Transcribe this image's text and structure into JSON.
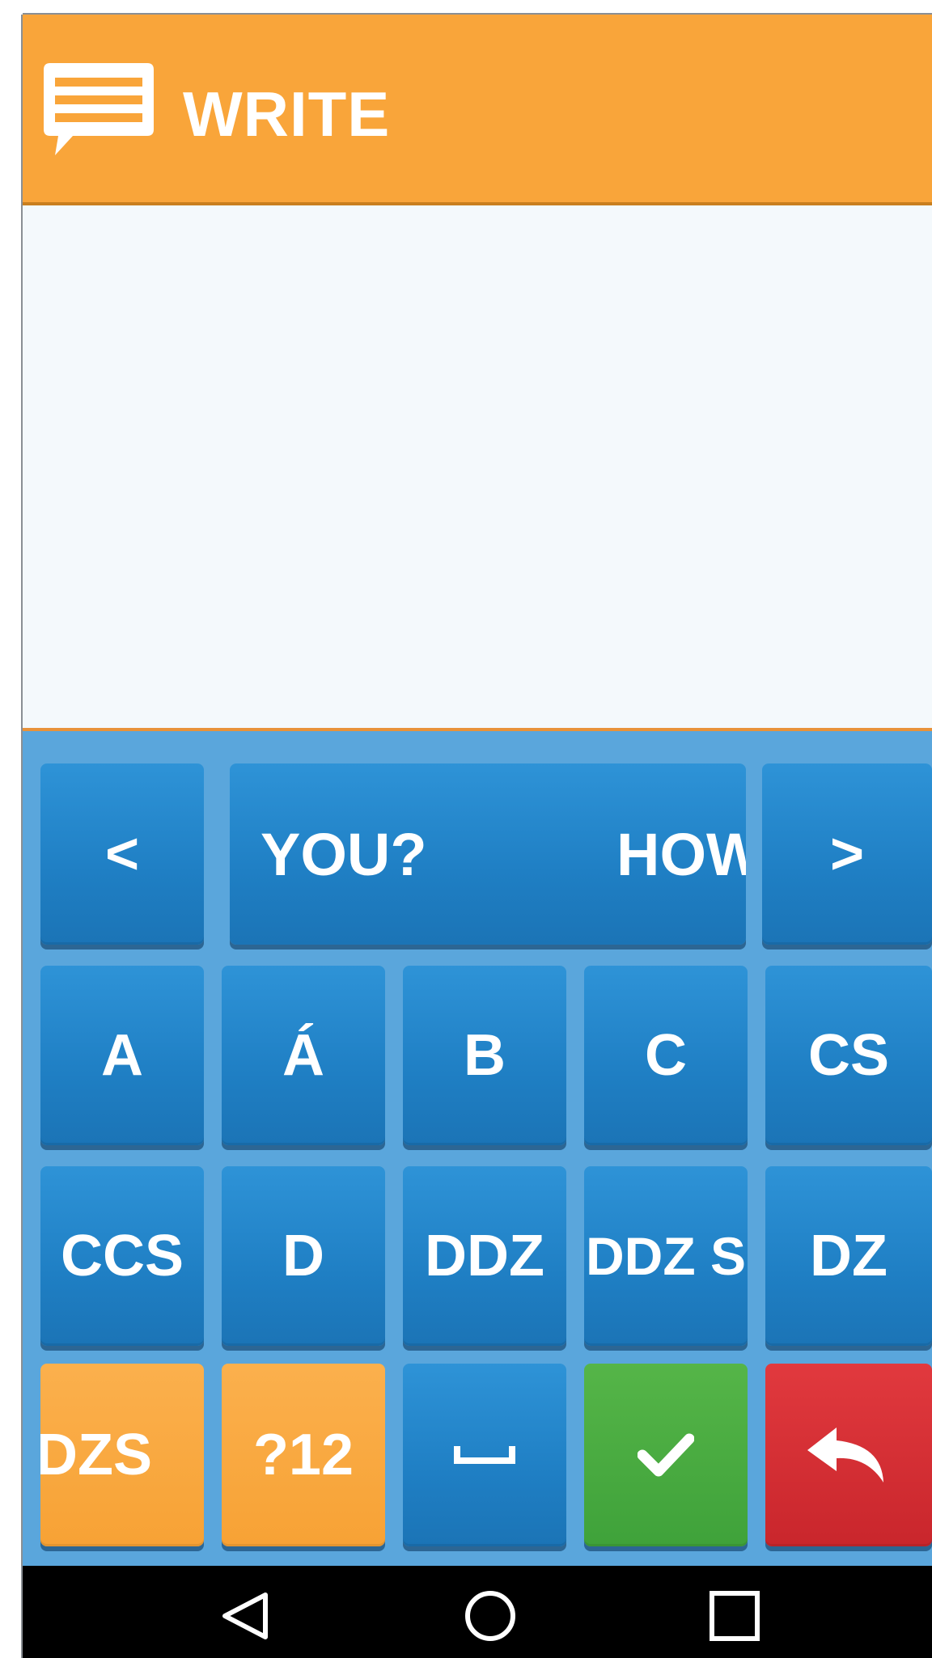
{
  "header": {
    "title": "WRITE",
    "icon": "chat-bubble-icon",
    "background": "#f9a53a"
  },
  "text_area": {
    "value": ""
  },
  "keyboard": {
    "background": "#5aa6dc",
    "nav": {
      "prev_label": "<",
      "next_label": ">"
    },
    "suggestions": [
      "YOU?",
      "HOW"
    ],
    "rows": [
      [
        "A",
        "Á",
        "B",
        "C",
        "CS"
      ],
      [
        "CCS",
        "D",
        "DDZ",
        "DDZ S",
        "DZ"
      ]
    ],
    "bottom_row": {
      "dzs_label": "DZS",
      "symbols_label": "?12",
      "space_icon": "space-bar-icon",
      "confirm_icon": "checkmark-icon",
      "undo_icon": "undo-arrow-icon"
    },
    "colors": {
      "key_blue": "#1f7fc4",
      "key_orange": "#f7a235",
      "key_green": "#3fa23a",
      "key_red": "#c9262c"
    }
  },
  "navigation_bar": {
    "icons": [
      "back-triangle-icon",
      "home-circle-icon",
      "recents-square-icon"
    ]
  }
}
